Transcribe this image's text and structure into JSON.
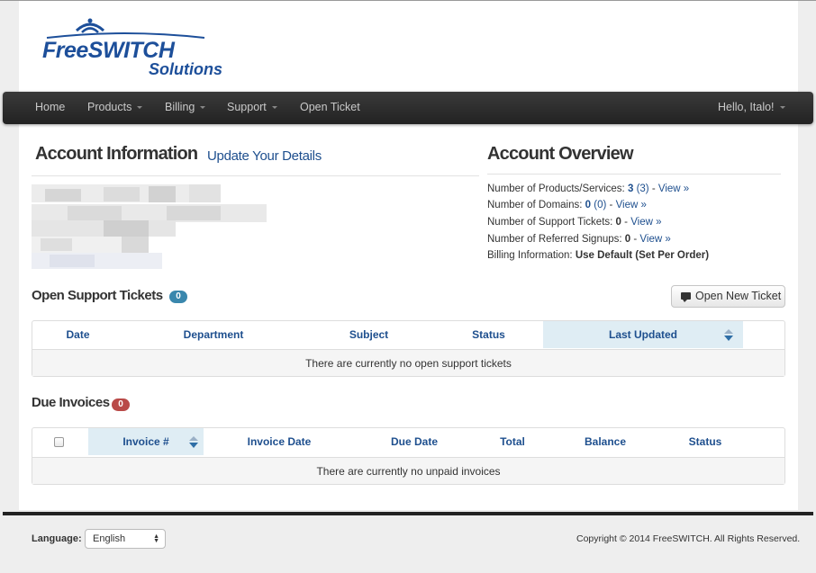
{
  "brand": {
    "line1": "FreeSWITCH",
    "line2": "Solutions",
    "color": "#1d4f9a"
  },
  "nav": {
    "items": [
      {
        "label": "Home",
        "dropdown": false
      },
      {
        "label": "Products",
        "dropdown": true
      },
      {
        "label": "Billing",
        "dropdown": true
      },
      {
        "label": "Support",
        "dropdown": true
      },
      {
        "label": "Open Ticket",
        "dropdown": false
      }
    ],
    "user": "Hello, Italo!"
  },
  "account": {
    "title": "Account Information",
    "update_link": "Update Your Details"
  },
  "overview": {
    "title": "Account Overview",
    "products": {
      "label": "Number of Products/Services:",
      "count": "3",
      "extra": "(3)",
      "link": "View »"
    },
    "domains": {
      "label": "Number of Domains:",
      "count": "0",
      "extra": "(0)",
      "link": "View »"
    },
    "tickets": {
      "label": "Number of Support Tickets:",
      "count": "0",
      "link": "View »"
    },
    "referrals": {
      "label": "Number of Referred Signups:",
      "count": "0",
      "link": "View »"
    },
    "billing": {
      "label": "Billing Information:",
      "value": "Use Default (Set Per Order)"
    }
  },
  "tickets": {
    "title": "Open Support Tickets",
    "badge": "0",
    "new_button": "Open New Ticket",
    "columns": [
      "Date",
      "Department",
      "Subject",
      "Status",
      "Last Updated"
    ],
    "empty": "There are currently no open support tickets"
  },
  "invoices": {
    "title": "Due Invoices",
    "badge": "0",
    "columns": [
      "Invoice #",
      "Invoice Date",
      "Due Date",
      "Total",
      "Balance",
      "Status"
    ],
    "empty": "There are currently no unpaid invoices"
  },
  "footer": {
    "language_label": "Language:",
    "language_value": "English",
    "copyright": "Copyright © 2014 FreeSWITCH. All Rights Reserved."
  }
}
